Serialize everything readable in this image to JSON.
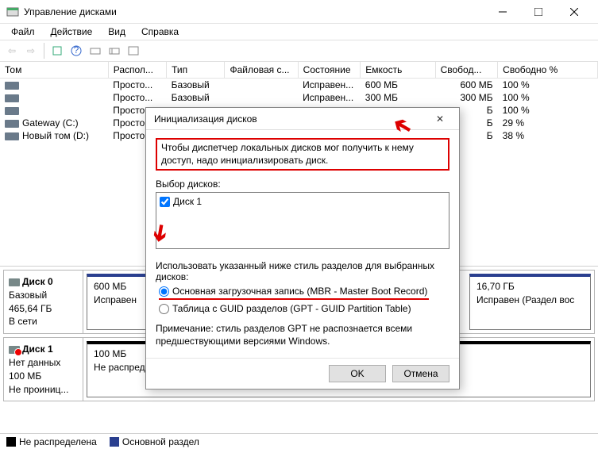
{
  "window": {
    "title": "Управление дисками"
  },
  "menu": {
    "file": "Файл",
    "action": "Действие",
    "view": "Вид",
    "help": "Справка"
  },
  "columns": {
    "tom": "Том",
    "rasp": "Распол...",
    "tip": "Тип",
    "fs": "Файловая с...",
    "state": "Состояние",
    "cap": "Емкость",
    "free": "Свобод...",
    "freepct": "Свободно %"
  },
  "rows": [
    {
      "tom": "",
      "rasp": "Просто...",
      "tip": "Базовый",
      "fs": "",
      "state": "Исправен...",
      "cap": "600 МБ",
      "free": "600 МБ",
      "freepct": "100 %"
    },
    {
      "tom": "",
      "rasp": "Просто...",
      "tip": "Базовый",
      "fs": "",
      "state": "Исправен...",
      "cap": "300 МБ",
      "free": "300 МБ",
      "freepct": "100 %"
    },
    {
      "tom": "",
      "rasp": "Просто...",
      "tip": "",
      "fs": "",
      "state": "",
      "cap": "",
      "free": "Б",
      "freepct": "100 %"
    },
    {
      "tom": "Gateway (C:)",
      "rasp": "Просто...",
      "tip": "",
      "fs": "",
      "state": "",
      "cap": "",
      "free": "Б",
      "freepct": "29 %"
    },
    {
      "tom": "Новый том (D:)",
      "rasp": "Просто...",
      "tip": "",
      "fs": "",
      "state": "",
      "cap": "",
      "free": "Б",
      "freepct": "38 %"
    }
  ],
  "dialog": {
    "title": "Инициализация дисков",
    "msg": "Чтобы диспетчер локальных дисков мог получить к нему доступ, надо инициализировать диск.",
    "select_label": "Выбор дисков:",
    "disk1": "Диск 1",
    "style_label": "Использовать указанный ниже стиль разделов для выбранных дисков:",
    "mbr": "Основная загрузочная запись (MBR - Master Boot Record)",
    "gpt": "Таблица с GUID разделов (GPT - GUID Partition Table)",
    "note": "Примечание: стиль разделов GPT не распознается всеми предшествующими версиями Windows.",
    "ok": "OK",
    "cancel": "Отмена"
  },
  "disk0": {
    "name": "Диск 0",
    "type": "Базовый",
    "size": "465,64 ГБ",
    "status": "В сети",
    "p1_size": "600 МБ",
    "p1_st": "Исправен",
    "p2_size": "16,70 ГБ",
    "p2_st": "Исправен (Раздел вос"
  },
  "disk1": {
    "name": "Диск 1",
    "type": "Нет данных",
    "size": "100 МБ",
    "status": "Не проиниц...",
    "p_size": "100 МБ",
    "p_st": "Не распределена"
  },
  "legend": {
    "unalloc": "Не распределена",
    "primary": "Основной раздел"
  }
}
